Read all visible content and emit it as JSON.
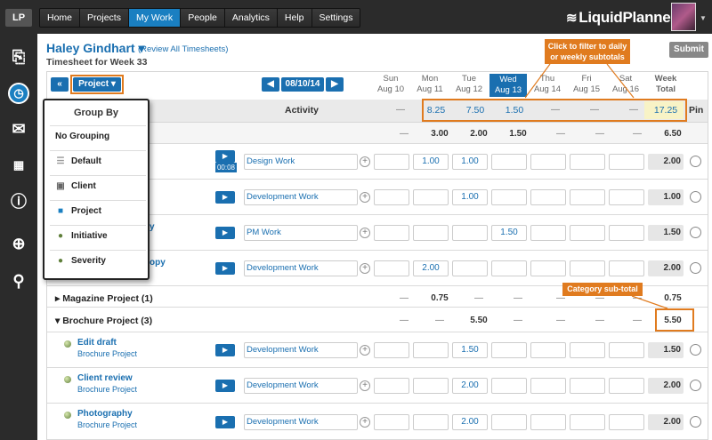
{
  "app": {
    "logo": "LP",
    "brand": "LiquidPlanner",
    "brand_mark": "®"
  },
  "nav": [
    "Home",
    "Projects",
    "My Work",
    "People",
    "Analytics",
    "Help",
    "Settings"
  ],
  "nav_active": "My Work",
  "header": {
    "user": "Haley Gindhart ▾",
    "review_link": "(Review All Timesheets)",
    "subtitle": "Timesheet for Week 33",
    "submit": "Submit"
  },
  "toolbar": {
    "prev": "«",
    "group_button": "Project ▾",
    "date_prev": "◀",
    "date": "08/10/14",
    "date_next": "▶"
  },
  "days": [
    {
      "dow": "Sun",
      "date": "Aug 10"
    },
    {
      "dow": "Mon",
      "date": "Aug 11"
    },
    {
      "dow": "Tue",
      "date": "Aug 12"
    },
    {
      "dow": "Wed",
      "date": "Aug 13"
    },
    {
      "dow": "Thu",
      "date": "Aug 14"
    },
    {
      "dow": "Fri",
      "date": "Aug 15"
    },
    {
      "dow": "Sat",
      "date": "Aug 16"
    }
  ],
  "week_header": [
    "Week",
    "Total"
  ],
  "columns": {
    "activity": "Activity",
    "pin": "Pin"
  },
  "daily_totals": [
    "—",
    "8.25",
    "7.50",
    "1.50",
    "—",
    "—",
    "—"
  ],
  "week_total": "17.25",
  "category_totals": {
    "first": {
      "days": [
        "—",
        "3.00",
        "2.00",
        "1.50",
        "—",
        "—",
        "—"
      ],
      "week": "6.50"
    },
    "magazine": {
      "name": "Magazine Project (1)",
      "days": [
        "—",
        "0.75",
        "—",
        "—",
        "—",
        "—",
        "—"
      ],
      "week": "0.75"
    },
    "brochure": {
      "name": "Brochure Project (3)",
      "days": [
        "—",
        "—",
        "5.50",
        "—",
        "—",
        "—",
        "—"
      ],
      "week": "5.50"
    }
  },
  "rows_top": [
    {
      "activity": "Design Work",
      "timer": "00:08",
      "cells": [
        "",
        "1.00",
        "1.00",
        "",
        "",
        "",
        ""
      ],
      "week": "2.00",
      "title": ""
    },
    {
      "activity": "Development Work",
      "cells": [
        "",
        "",
        "1.00",
        "",
        "",
        "",
        ""
      ],
      "week": "1.00",
      "title": ""
    },
    {
      "activity": "PM Work",
      "cells": [
        "",
        "",
        "",
        "1.50",
        "",
        "",
        ""
      ],
      "week": "1.50",
      "title": "y"
    },
    {
      "activity": "Development Work",
      "cells": [
        "",
        "2.00",
        "",
        "",
        "",
        "",
        ""
      ],
      "week": "2.00",
      "title": "opy"
    }
  ],
  "rows_brochure": [
    {
      "task": "Edit draft",
      "project": "Brochure Project",
      "activity": "Development Work",
      "cells": [
        "",
        "",
        "1.50",
        "",
        "",
        "",
        ""
      ],
      "week": "1.50"
    },
    {
      "task": "Client review",
      "project": "Brochure Project",
      "activity": "Development Work",
      "cells": [
        "",
        "",
        "2.00",
        "",
        "",
        "",
        ""
      ],
      "week": "2.00"
    },
    {
      "task": "Photography",
      "project": "Brochure Project",
      "activity": "Development Work",
      "cells": [
        "",
        "",
        "2.00",
        "",
        "",
        "",
        ""
      ],
      "week": "2.00"
    }
  ],
  "callouts": {
    "filter": "Click to filter to daily or weekly subtotals",
    "subtotal": "Category sub-total"
  },
  "group_by": {
    "title": "Group By",
    "items": [
      {
        "label": "No Grouping",
        "icon": ""
      },
      {
        "label": "Default",
        "icon": "list-icon"
      },
      {
        "label": "Client",
        "icon": "briefcase-icon"
      },
      {
        "label": "Project",
        "icon": "folder-icon"
      },
      {
        "label": "Initiative",
        "icon": "dot-icon"
      },
      {
        "label": "Severity",
        "icon": "dot-icon"
      }
    ]
  },
  "colors": {
    "accent": "#1a6fb0",
    "callout": "#e07b1f",
    "nav_bg": "#2b2b2b",
    "highlight": "#f8f3c6"
  }
}
